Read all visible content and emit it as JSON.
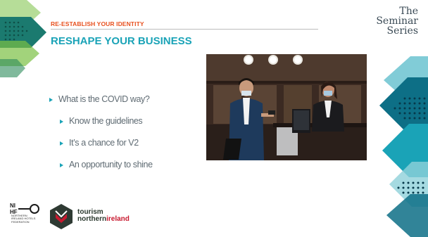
{
  "slide": {
    "eyebrow": "RE-ESTABLISH YOUR IDENTITY",
    "title": "RESHAPE YOUR BUSINESS",
    "brand": {
      "line1": "The",
      "line2": "Seminar",
      "line3": "Series"
    },
    "bullets": [
      {
        "text": "What is the COVID way?",
        "level": 1
      },
      {
        "text": "Know the guidelines",
        "level": 2
      },
      {
        "text": "It’s a chance for V2",
        "level": 2
      },
      {
        "text": "An opportunity to shine",
        "level": 2
      }
    ],
    "logos": {
      "nihf_mark": "NI HF",
      "nihf_name": "NORTHERN IRELAND HOTELS FEDERATION",
      "tourism_line1": "tourism",
      "tourism_line2_a": "northern",
      "tourism_line2_b": "ireland"
    }
  },
  "colors": {
    "accent_orange": "#e8501e",
    "accent_teal": "#1aa3b7",
    "body_text": "#5f6b73"
  },
  "icons": {
    "bullet": "triangle-bullet-icon",
    "photo": "hotel-reception-photo"
  }
}
